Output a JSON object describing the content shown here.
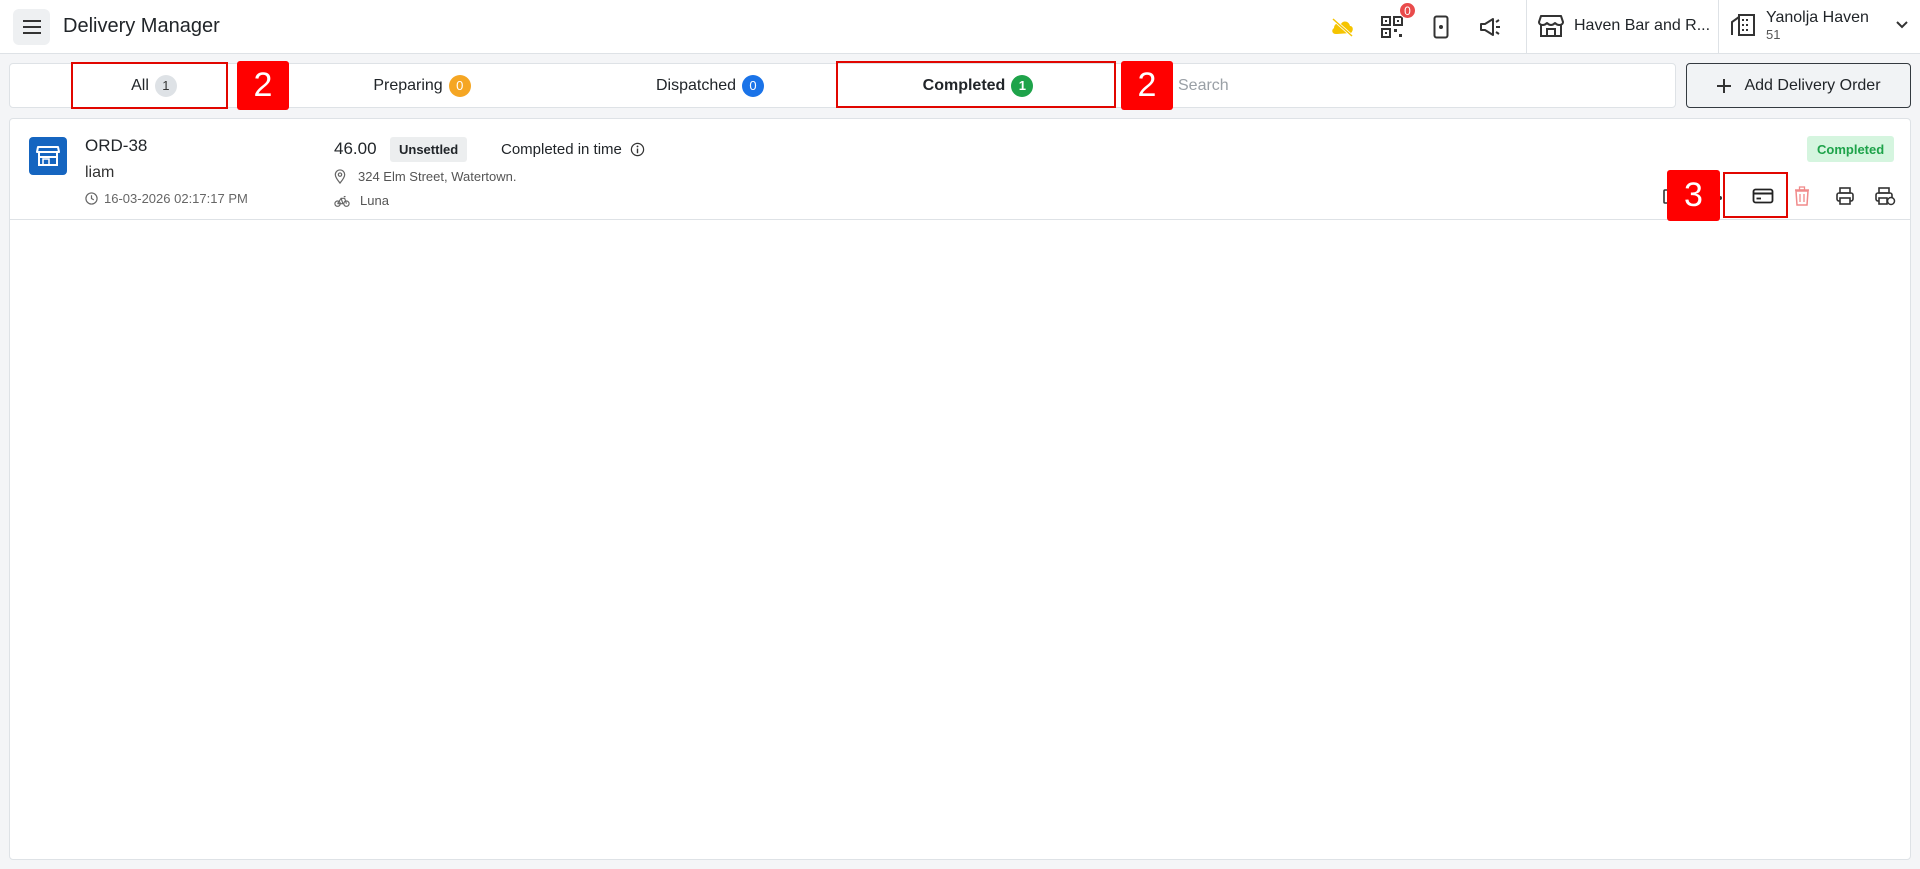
{
  "header": {
    "title": "Delivery Manager",
    "qr_count": "0",
    "branch": "Haven Bar and R...",
    "user_name": "Yanolja Haven",
    "user_sub": "51"
  },
  "tabs": [
    {
      "label": "All",
      "count": "1",
      "badge_color": "#dee2e6",
      "badge_text": "#333333"
    },
    {
      "label": "Preparing",
      "count": "0",
      "badge_color": "#f5a623",
      "badge_text": "#ffffff"
    },
    {
      "label": "Dispatched",
      "count": "0",
      "badge_color": "#1a73e8",
      "badge_text": "#ffffff"
    },
    {
      "label": "Completed",
      "count": "1",
      "badge_color": "#1ea34a",
      "badge_text": "#ffffff"
    }
  ],
  "search": {
    "placeholder": "Search"
  },
  "add_button": {
    "label": "Add Delivery Order"
  },
  "order": {
    "id": "ORD-38",
    "customer": "liam",
    "datetime": "16-03-2026 02:17:17 PM",
    "amount": "46.00",
    "payment_status": "Unsettled",
    "timing": "Completed in time",
    "address": "324 Elm Street, Watertown.",
    "driver": "Luna",
    "status": "Completed"
  },
  "annotations": {
    "tabs_marker": "2",
    "tabs_marker_2": "2",
    "action_marker": "3"
  },
  "colors": {
    "accent": "#1565c0",
    "highlight": "#ff0000",
    "success": "#1ea34a"
  }
}
